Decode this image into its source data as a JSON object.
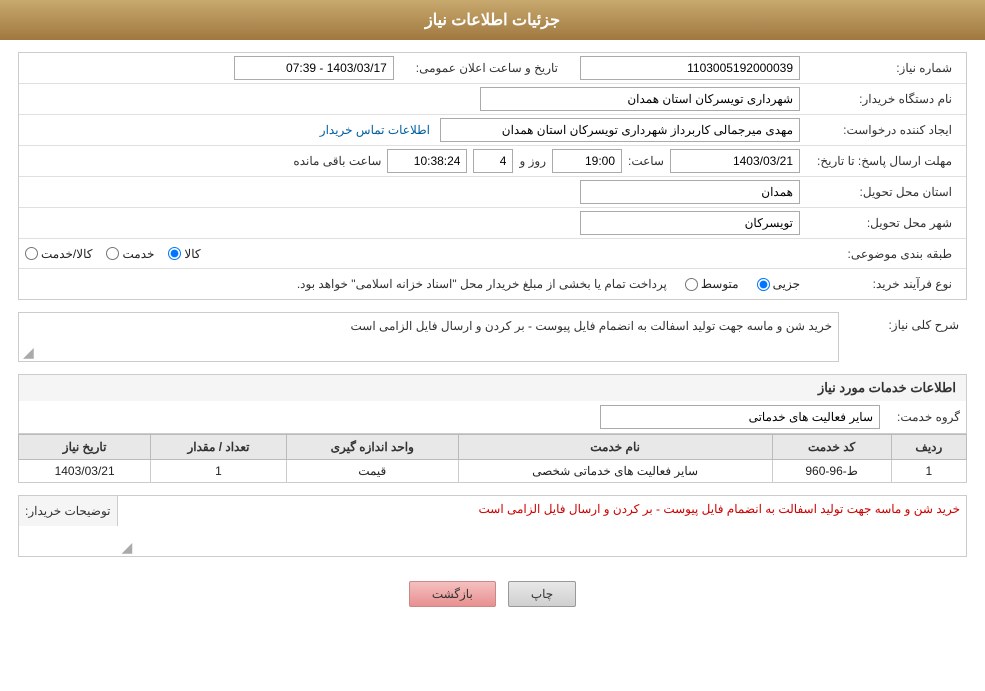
{
  "header": {
    "title": "جزئیات اطلاعات نیاز"
  },
  "fields": {
    "need_number_label": "شماره نیاز:",
    "need_number_value": "1103005192000039",
    "announce_datetime_label": "تاریخ و ساعت اعلان عمومی:",
    "announce_datetime_value": "1403/03/17 - 07:39",
    "buyer_org_label": "نام دستگاه خریدار:",
    "buyer_org_value": "شهرداری تویسرکان استان همدان",
    "creator_label": "ایجاد کننده درخواست:",
    "creator_value": "مهدی میرجمالی کاربرداز شهرداری تویسرکان استان همدان",
    "creator_link": "اطلاعات تماس خریدار",
    "deadline_label": "مهلت ارسال پاسخ: تا تاریخ:",
    "deadline_date": "1403/03/21",
    "deadline_time_label": "ساعت:",
    "deadline_time": "19:00",
    "deadline_days_label": "روز و",
    "deadline_days": "4",
    "deadline_remaining_label": "ساعت باقی مانده",
    "deadline_remaining": "10:38:24",
    "province_label": "استان محل تحویل:",
    "province_value": "همدان",
    "city_label": "شهر محل تحویل:",
    "city_value": "تویسرکان",
    "category_label": "طبقه بندی موضوعی:",
    "category_kala": "کالا",
    "category_khadamat": "خدمت",
    "category_kala_khadamat": "کالا/خدمت",
    "purchase_type_label": "نوع فرآیند خرید:",
    "purchase_type_jozvi": "جزیی",
    "purchase_type_motovaset": "متوسط",
    "purchase_type_desc": "پرداخت تمام یا بخشی از مبلغ خریدار محل \"اسناد خزانه اسلامی\" خواهد بود.",
    "need_summary_label": "شرح کلی نیاز:",
    "need_summary_value": "خرید شن و ماسه جهت تولید اسفالت به انضمام فایل پیوست - بر کردن و ارسال فایل الزامی است",
    "services_info_label": "اطلاعات خدمات مورد نیاز",
    "service_group_label": "گروه خدمت:",
    "service_group_value": "سایر فعالیت های خدماتی",
    "table": {
      "col_row": "ردیف",
      "col_code": "کد خدمت",
      "col_name": "نام خدمت",
      "col_unit": "واحد اندازه گیری",
      "col_qty": "تعداد / مقدار",
      "col_date": "تاریخ نیاز",
      "rows": [
        {
          "row": "1",
          "code": "ط-96-960",
          "name": "سایر فعالیت های خدماتی شخصی",
          "unit": "قیمت",
          "qty": "1",
          "date": "1403/03/21"
        }
      ]
    },
    "buyer_desc_label": "توضیحات خریدار:",
    "buyer_desc_value": "خرید شن و ماسه جهت تولید اسفالت به انضمام فایل پیوست - بر کردن و ارسال فایل الزامی است",
    "btn_print": "چاپ",
    "btn_back": "بازگشت"
  }
}
